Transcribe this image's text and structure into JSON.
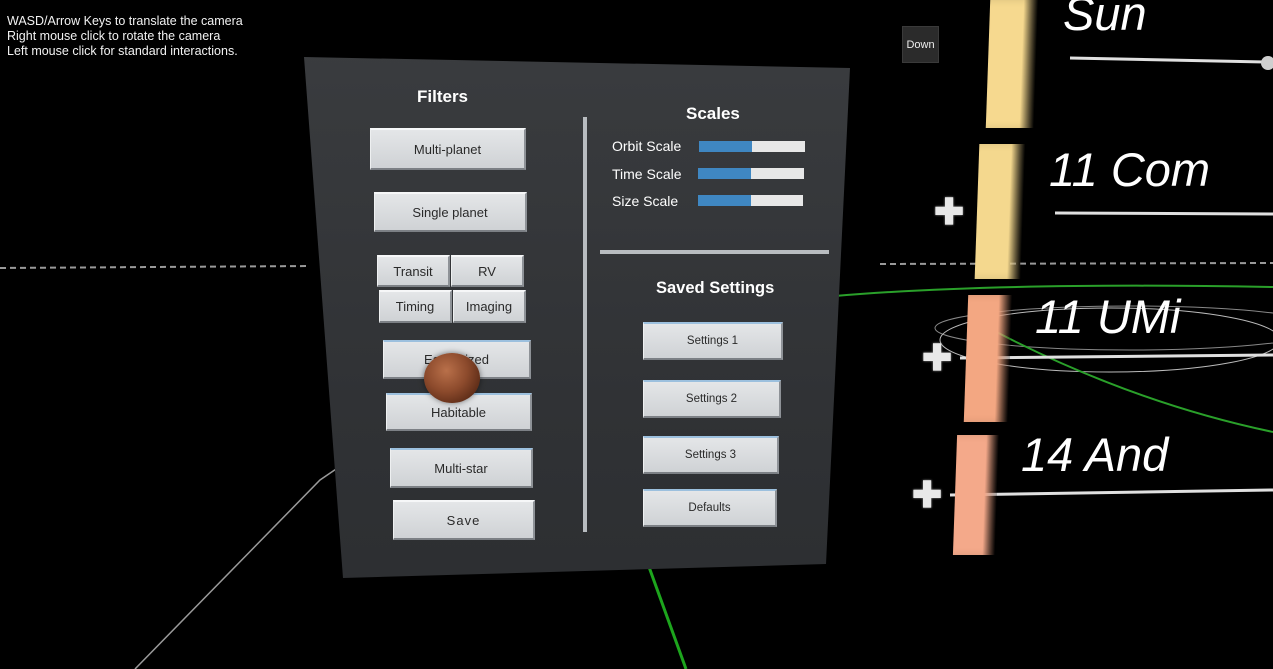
{
  "help_text": {
    "line1": "WASD/Arrow Keys to translate the camera",
    "line2": "Right mouse click to rotate the camera",
    "line3": "Left mouse click for standard interactions."
  },
  "camera": {
    "down_label": "Down"
  },
  "filters": {
    "title": "Filters",
    "multi_planet": "Multi-planet",
    "single_planet": "Single planet",
    "transit": "Transit",
    "rv": "RV",
    "timing": "Timing",
    "imaging": "Imaging",
    "earth_sized": "Earth sized",
    "habitable": "Habitable",
    "multi_star": "Multi-star",
    "save": "Save"
  },
  "scales": {
    "title": "Scales",
    "items": [
      {
        "label": "Orbit Scale",
        "value": 0.5
      },
      {
        "label": "Time Scale",
        "value": 0.5
      },
      {
        "label": "Size Scale",
        "value": 0.5
      }
    ]
  },
  "saved_settings": {
    "title": "Saved Settings",
    "settings1": "Settings 1",
    "settings2": "Settings 2",
    "settings3": "Settings 3",
    "defaults": "Defaults"
  },
  "systems": [
    {
      "label": "Sun",
      "color": "#f6d98f"
    },
    {
      "label": "11 Com",
      "color": "#f4d88e"
    },
    {
      "label": "11 UMi",
      "color": "#f3a782"
    },
    {
      "label": "14 And",
      "color": "#f4a98a"
    }
  ],
  "colors": {
    "accent_blue": "#3f87c2",
    "orbit_green": "#1a9a1a",
    "panel": "#35373a"
  }
}
